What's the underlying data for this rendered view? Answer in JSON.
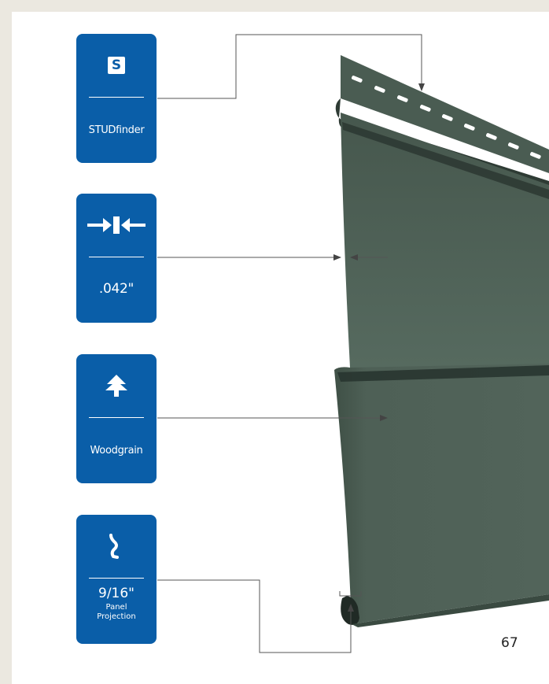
{
  "badges": {
    "studfinder": {
      "icon": "letter-s-icon",
      "letter": "S",
      "label": "STUDfinder"
    },
    "thickness": {
      "icon": "compress-arrows-icon",
      "label": ".042\""
    },
    "woodgrain": {
      "icon": "tree-icon",
      "label": "Woodgrain"
    },
    "projection": {
      "icon": "curved-arrow-icon",
      "label": "9/16\"",
      "sub_line1": "Panel",
      "sub_line2": "Projection"
    }
  },
  "page_number": "67",
  "colors": {
    "badge_blue": "#0a5ea8",
    "siding_green": "#4d5f55",
    "page_border": "#ebe8e0"
  }
}
